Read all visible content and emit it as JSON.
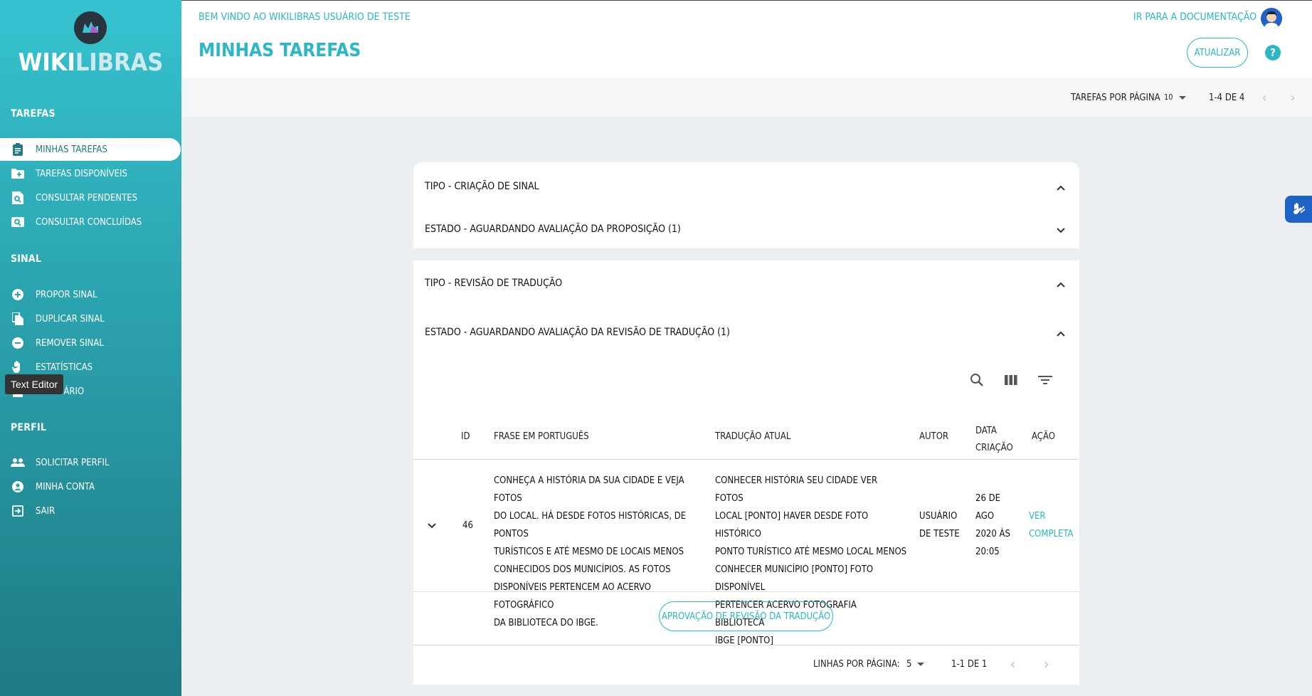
{
  "app": {
    "name_part1": "WIKI",
    "name_part2": "LIBRAS"
  },
  "header": {
    "welcome": "Bem vindo ao WikiLibras Usuário de Teste",
    "title": "Minhas Tarefas",
    "doc_link": "Ir para a documentação",
    "refresh_label": "Atualizar",
    "help_icon": "?"
  },
  "sidebar": {
    "sections": [
      {
        "title": "Tarefas",
        "items": [
          {
            "label": "Minhas Tarefas",
            "icon": "assignment-icon",
            "active": true
          },
          {
            "label": "Tarefas Disponíveis",
            "icon": "folder-add-icon"
          },
          {
            "label": "Consultar Pendentes",
            "icon": "find-in-page-icon"
          },
          {
            "label": "Consultar Concluídas",
            "icon": "image-search-icon"
          }
        ]
      },
      {
        "title": "Sinal",
        "items": [
          {
            "label": "Propor Sinal",
            "icon": "add-circle-icon"
          },
          {
            "label": "Duplicar Sinal",
            "icon": "copy-icon"
          },
          {
            "label": "Remover Sinal",
            "icon": "remove-circle-icon"
          },
          {
            "label": "Estatísticas",
            "icon": "hand-icon"
          },
          {
            "label": "Glossário",
            "icon": "book-icon"
          }
        ]
      },
      {
        "title": "Perfil",
        "items": [
          {
            "label": "Solicitar Perfil",
            "icon": "people-icon"
          },
          {
            "label": "Minha Conta",
            "icon": "account-circle-icon"
          },
          {
            "label": "Sair",
            "icon": "exit-icon"
          }
        ]
      }
    ]
  },
  "tooltip": "Text Editor",
  "top_pagination": {
    "label": "Tarefas por página",
    "per_page": "10",
    "range": "1-4 de 4"
  },
  "groups": [
    {
      "tipo": "Tipo - Criação de Sinal",
      "estado": "Estado - Aguardando Avaliação da Proposição (1)"
    },
    {
      "tipo": "Tipo - Revisão de Tradução",
      "estado": "Estado - Aguardando Avaliação da Revisão de Tradução (1)"
    }
  ],
  "table": {
    "headers": {
      "id": "ID",
      "frase": "Frase em Português",
      "traducao": "Tradução Atual",
      "autor": "Autor",
      "data1": "Data",
      "data2": "Criação",
      "acao": "Ação"
    },
    "row": {
      "id": "46",
      "frase": [
        "Conheça a história da sua cidade e veja fotos",
        "do local. Há desde fotos históricas, de pontos",
        "turísticos e até mesmo de locais menos",
        "conhecidos dos municípios. As fotos",
        "disponíveis pertencem ao acervo fotográfico",
        "da Biblioteca do IBGE."
      ],
      "traducao": [
        "CONHECER HISTÓRIA SEU CIDADE VER FOTOS",
        "LOCAL [PONTO] HAVER DESDE FOTO HISTÓRICO",
        "PONTO TURÍSTICO ATÉ MESMO LOCAL MENOS",
        "CONHECER MUNICÍPIO [PONTO] FOTO DISPONÍVEL",
        "PERTENCER ACERVO FOTOGRAFIA BIBLIOTECA",
        "IBGE [PONTO]"
      ],
      "autor": [
        "Usuário",
        "de Teste"
      ],
      "data": [
        "26 de",
        "ago",
        "2020 às",
        "20:05"
      ],
      "acao": [
        "Ver",
        "completa"
      ]
    },
    "approve_label": "Aprovação de Revisão da Tradução",
    "pagination": {
      "label": "Linhas por página:",
      "per_page": "5",
      "range": "1-1 de 1"
    }
  },
  "colors": {
    "accent": "#2bb7c4",
    "sidebar_top": "#35c3cf",
    "sidebar_bottom": "#1e7a84",
    "fab": "#1d62c4"
  }
}
